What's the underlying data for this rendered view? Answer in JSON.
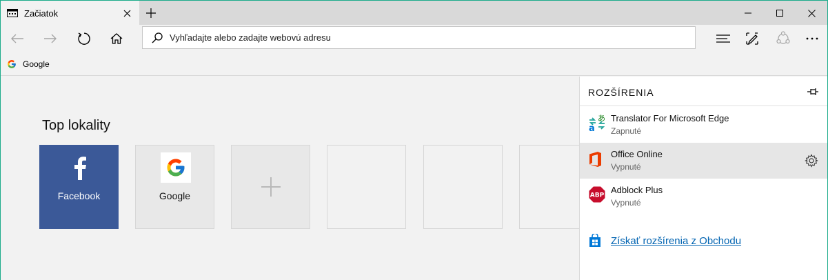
{
  "tab": {
    "title": "Začiatok"
  },
  "address_bar": {
    "placeholder": "Vyhľadajte alebo zadajte webovú adresu"
  },
  "favorites": [
    {
      "label": "Google"
    }
  ],
  "top_sites": {
    "title": "Top lokality",
    "tiles": [
      {
        "label": "Facebook",
        "color": "#3b5998"
      },
      {
        "label": "Google",
        "color": "#e8e8e8"
      }
    ]
  },
  "extensions_panel": {
    "title": "ROZŠÍRENIA",
    "items": [
      {
        "name": "Translator For Microsoft Edge",
        "status": "Zapnuté",
        "icon": "translator-icon"
      },
      {
        "name": "Office Online",
        "status": "Vypnuté",
        "icon": "office-icon"
      },
      {
        "name": "Adblock Plus",
        "status": "Vypnuté",
        "icon": "adblock-icon",
        "icon_text": "ABP"
      }
    ],
    "store_link": "Získať rozšírenia z Obchodu"
  },
  "colors": {
    "window_border": "#1aab8a",
    "facebook": "#3b5998",
    "link": "#0063b1",
    "office": "#eb3c00",
    "adblock": "#c70d2c",
    "store": "#0078d7"
  }
}
